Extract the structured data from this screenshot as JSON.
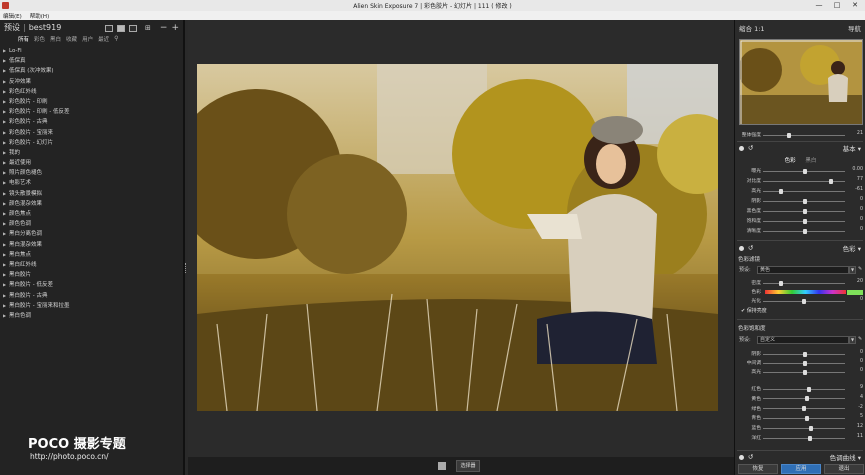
{
  "window": {
    "title": "Alien Skin Exposure 7 | 彩色胶片 - 幻灯片 | 111 ( 修改 )",
    "minimize": "—",
    "maximize": "□",
    "close": "✕"
  },
  "menu": [
    "编辑(E)",
    "帮助(H)"
  ],
  "left": {
    "tab_preset": "预设",
    "separator": "|",
    "user": "best919",
    "subtabs": [
      "所有",
      "彩色",
      "黑白",
      "收藏",
      "用户",
      "最近"
    ],
    "items": [
      "Lo-Fi",
      "低保真",
      "低保真 (次冲效果)",
      "反冲效果",
      "彩色红外线",
      "彩色胶片 - 印刷",
      "彩色胶片 - 印刷 - 低反差",
      "彩色胶片 - 古典",
      "彩色胶片 - 宝丽来",
      "彩色胶片 - 幻灯片",
      "我的",
      "最近使用",
      "照片颜色褪色",
      "电影艺术",
      "镜头散景模拟",
      "颜色混杂效果",
      "颜色焦点",
      "颜色色调",
      "黑白分离色调",
      "黑白混杂效果",
      "黑白焦点",
      "黑白红外线",
      "黑白胶片",
      "黑白胶片 - 低反差",
      "黑白胶片 - 古典",
      "黑白胶片 - 宝丽来和拉墨",
      "黑白色调"
    ]
  },
  "watermark": {
    "brand": "POCO 摄影专题",
    "url": "http://photo.poco.cn/"
  },
  "bottom": {
    "button": "选择器"
  },
  "right": {
    "nav": {
      "zoom_label": "缩合",
      "zoom_ratio": "1:1",
      "title": "导航"
    },
    "overall": {
      "label": "整体强度",
      "value": "21",
      "level": 0.3
    },
    "basic": {
      "title": "基本",
      "tab_color": "色彩",
      "tab_bw": "黑白",
      "sliders": [
        {
          "label": "曝光",
          "value": "0.00",
          "pos": 0.5
        },
        {
          "label": "对比度",
          "value": "77",
          "pos": 0.82
        },
        {
          "label": "高光",
          "value": "-61",
          "pos": 0.2
        },
        {
          "label": "阴影",
          "value": "0",
          "pos": 0.5
        },
        {
          "label": "黑色度",
          "value": "0",
          "pos": 0.5
        },
        {
          "label": "饱和度",
          "value": "0",
          "pos": 0.5
        },
        {
          "label": "清晰度",
          "value": "0",
          "pos": 0.5
        }
      ]
    },
    "color": {
      "title": "色彩",
      "overlay_title": "色彩滤镜",
      "preset_label": "预设:",
      "preset_value": "黄色",
      "density_label": "密度",
      "density_value": "20",
      "density_pos": 0.2,
      "hue_label": "色彩",
      "brightness_label": "光化",
      "brightness_value": "0",
      "preserve_label": "保持亮度",
      "sat_title": "色彩饱和度",
      "sat_preset_label": "预设:",
      "sat_preset_value": "自定义",
      "tone_sliders": [
        {
          "label": "阴影",
          "value": "0",
          "pos": 0.5
        },
        {
          "label": "中间调",
          "value": "0",
          "pos": 0.5
        },
        {
          "label": "高光",
          "value": "0",
          "pos": 0.5
        }
      ],
      "hue_sliders": [
        {
          "label": "红色",
          "value": "9",
          "pos": 0.55
        },
        {
          "label": "黄色",
          "value": "4",
          "pos": 0.52
        },
        {
          "label": "绿色",
          "value": "-2",
          "pos": 0.49
        },
        {
          "label": "青色",
          "value": "5",
          "pos": 0.53
        },
        {
          "label": "蓝色",
          "value": "12",
          "pos": 0.57
        },
        {
          "label": "洋红",
          "value": "11",
          "pos": 0.56
        }
      ]
    },
    "curves": {
      "title": "色调曲线"
    },
    "buttons": [
      "恢复",
      "应用",
      "退出"
    ]
  }
}
